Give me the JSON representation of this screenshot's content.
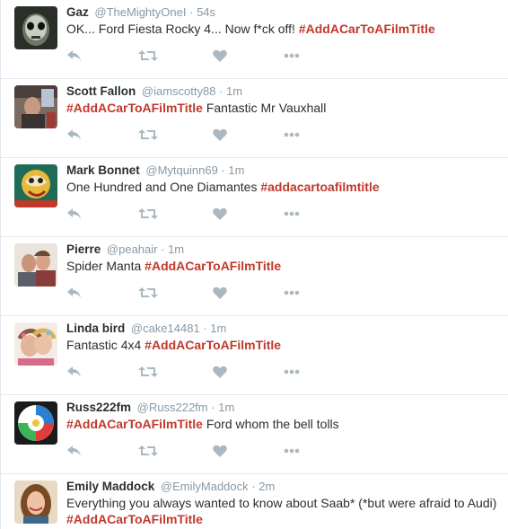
{
  "icons": {
    "reply": "reply-icon",
    "retweet": "retweet-icon",
    "like": "heart-icon",
    "more": "more-dots-icon"
  },
  "colors": {
    "hashtag": "#c0392b",
    "meta": "#8899a6",
    "icon": "#aab8c2",
    "divider": "#e1e8ed"
  },
  "tweets": [
    {
      "name": "Gaz",
      "handle": "@TheMightyOneI",
      "dot": "·",
      "time": "54s",
      "text_before": "OK... Ford Fiesta Rocky 4... Now f*ck off!",
      "hashtag": "#AddACarToAFilmTitle",
      "text_after": ""
    },
    {
      "name": "Scott Fallon",
      "handle": "@iamscotty88",
      "dot": "·",
      "time": "1m",
      "text_before": "",
      "hashtag": "#AddACarToAFilmTitle",
      "text_after": "Fantastic Mr Vauxhall"
    },
    {
      "name": "Mark Bonnet",
      "handle": "@Mytquinn69",
      "dot": "·",
      "time": "1m",
      "text_before": "One Hundred and One Diamantes",
      "hashtag": "#addacartoafilmtitle",
      "text_after": ""
    },
    {
      "name": "Pierre",
      "handle": "@peahair",
      "dot": "·",
      "time": "1m",
      "text_before": "Spider Manta",
      "hashtag": "#AddACarToAFilmTitle",
      "text_after": ""
    },
    {
      "name": "Linda bird",
      "handle": "@cake14481",
      "dot": "·",
      "time": "1m",
      "text_before": "Fantastic 4x4",
      "hashtag": "#AddACarToAFilmTitle",
      "text_after": ""
    },
    {
      "name": "Russ222fm",
      "handle": "@Russ222fm",
      "dot": "·",
      "time": "1m",
      "text_before": "",
      "hashtag": "#AddACarToAFilmTitle",
      "text_after": "Ford whom the bell tolls"
    },
    {
      "name": "Emily Maddock",
      "handle": "@EmilyMaddock",
      "dot": "·",
      "time": "2m",
      "text_before": "Everything you always wanted to know about Saab* (*but were afraid to Audi)",
      "hashtag": "#AddACarToAFilmTitle",
      "text_after": ""
    }
  ]
}
